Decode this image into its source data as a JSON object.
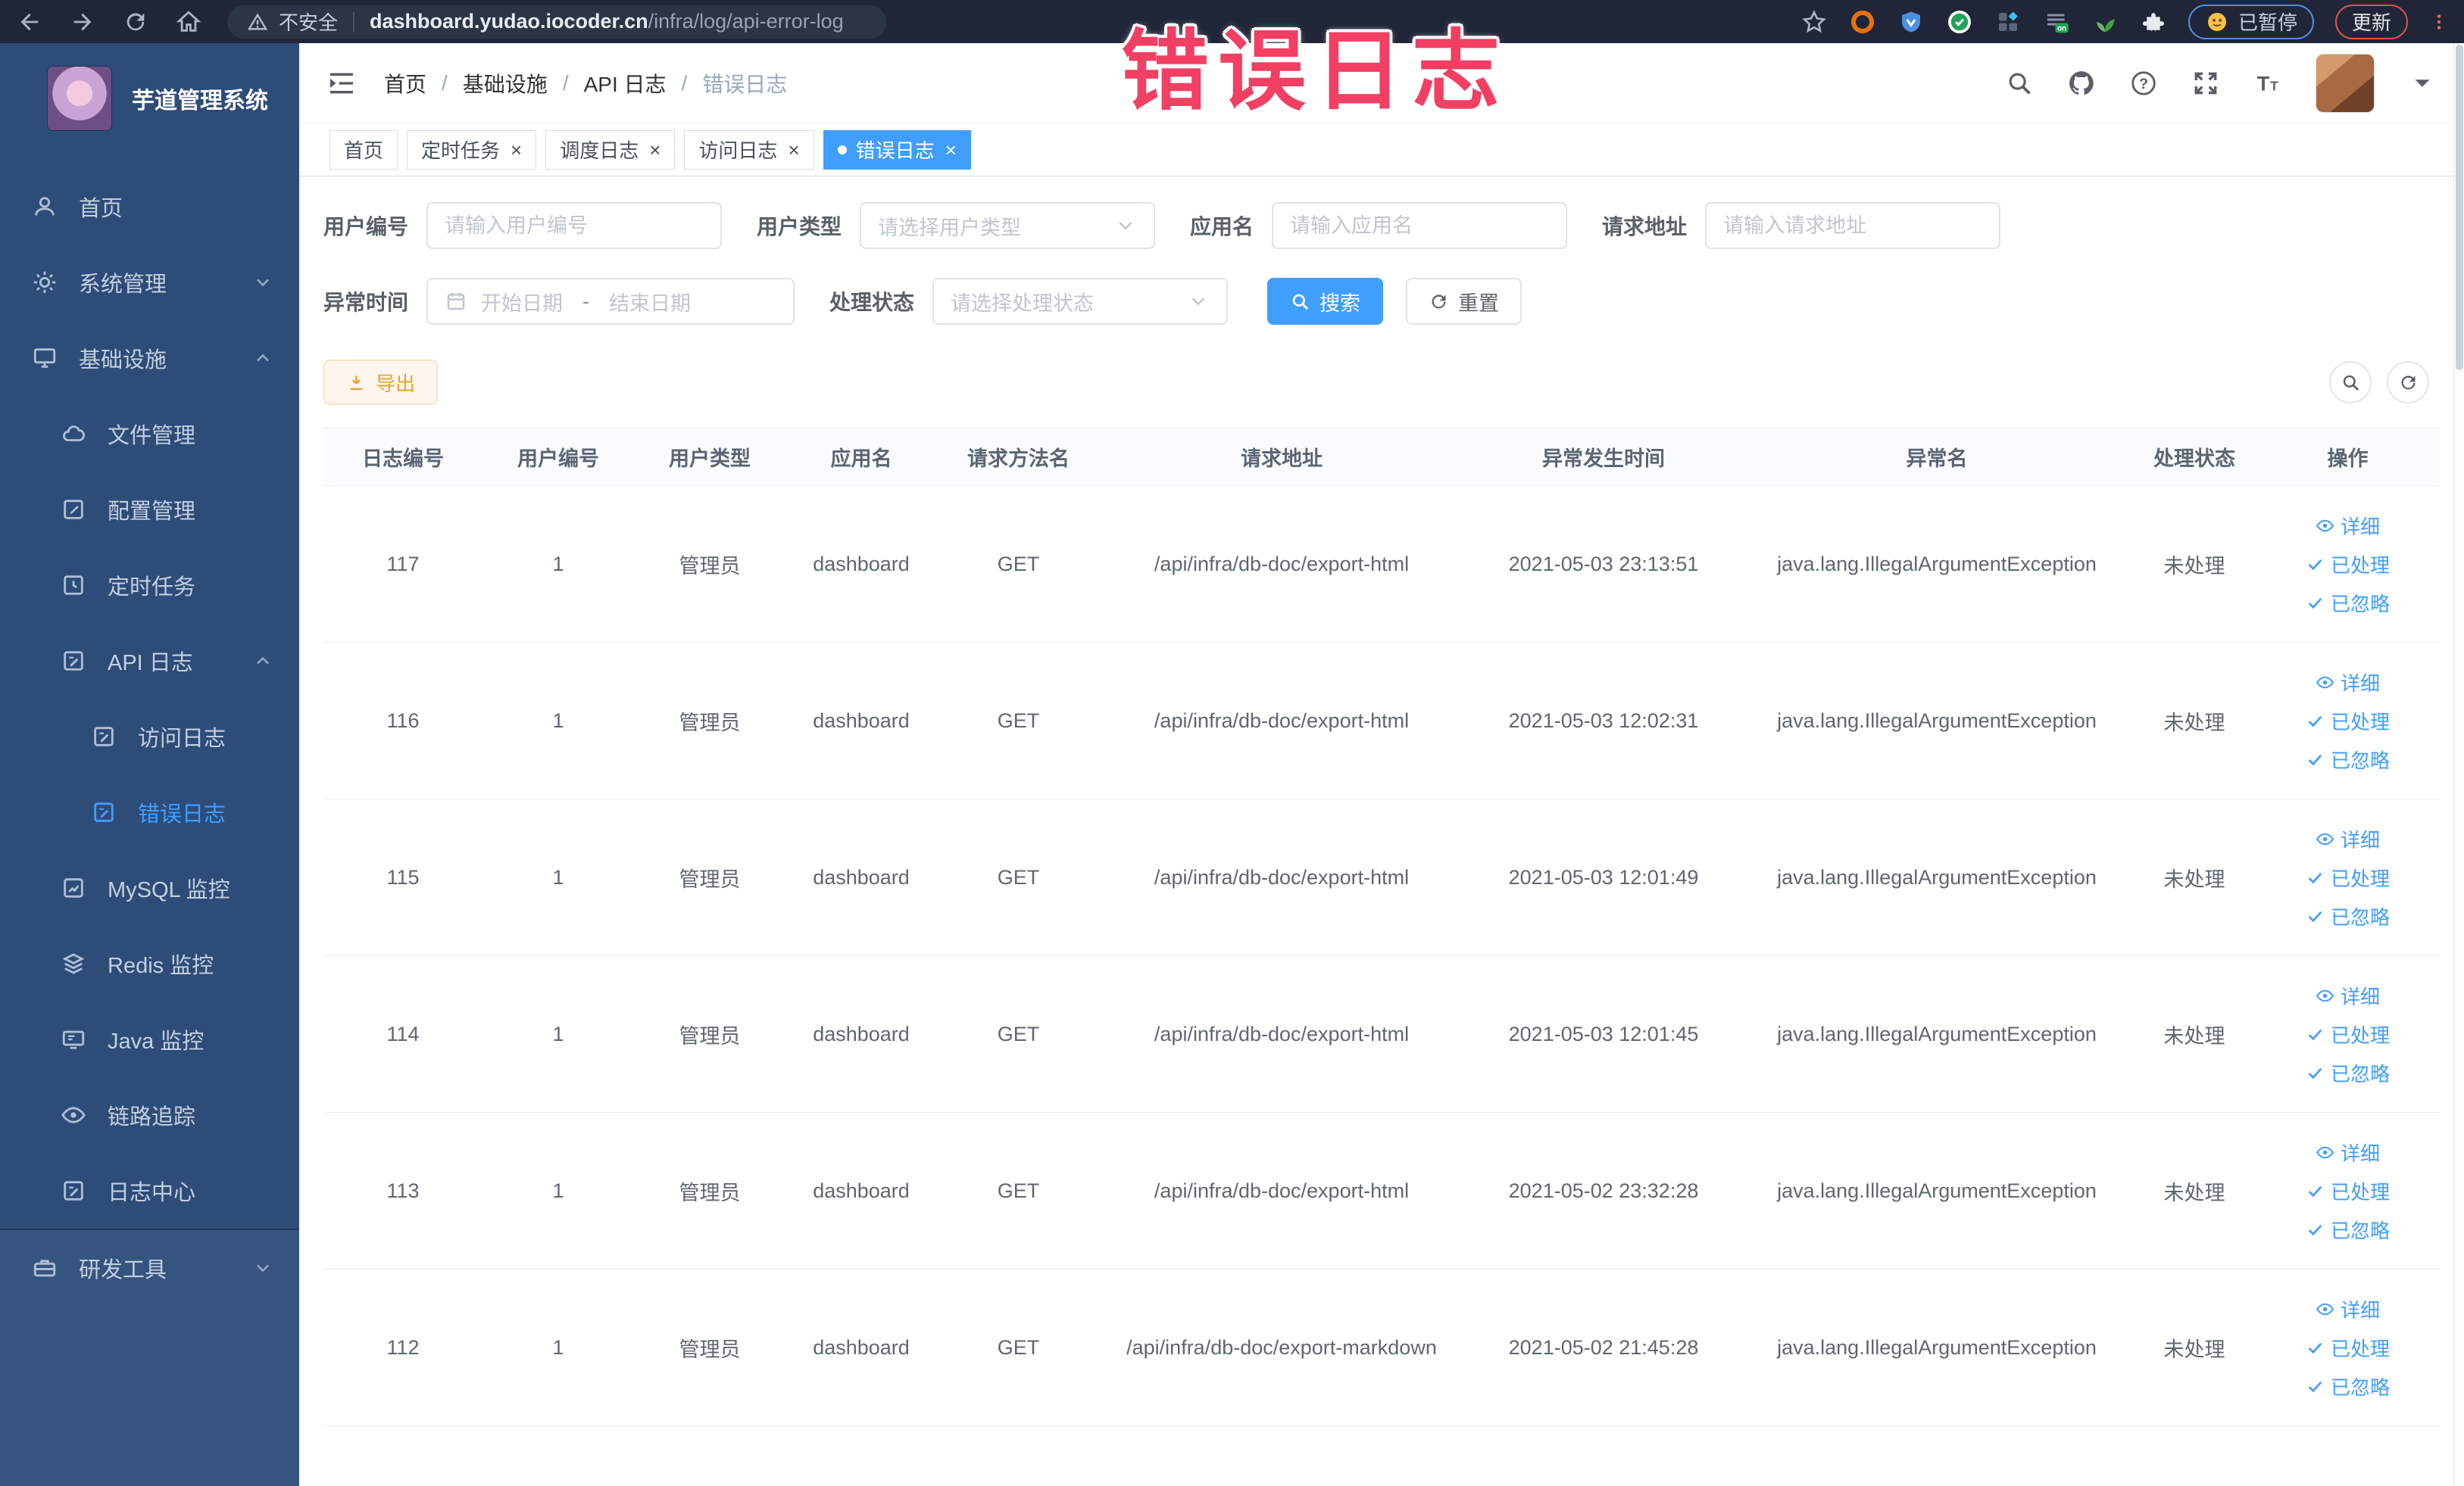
{
  "browser": {
    "security_label": "不安全",
    "url_host": "dashboard.yudao.iocoder.cn",
    "url_path": "/infra/log/api-error-log",
    "extensions": [
      "bookmark-star-icon",
      "ext-orange-icon",
      "ext-shield-icon",
      "ext-green-icon",
      "ext-grid-icon",
      "ext-on-icon",
      "ext-leaf-icon",
      "puzzle-icon"
    ],
    "paused_badge": "已暂停",
    "update_button": "更新"
  },
  "overlay": {
    "text": "错误日志",
    "color": "#f23f63"
  },
  "sidebar": {
    "title": "芋道管理系统",
    "items": [
      {
        "key": "home",
        "label": "首页",
        "icon": "user-icon",
        "level": 0
      },
      {
        "key": "system-management",
        "label": "系统管理",
        "icon": "gear-icon",
        "level": 0,
        "chevron": "down"
      },
      {
        "key": "infrastructure",
        "label": "基础设施",
        "icon": "monitor-icon",
        "level": 0,
        "chevron": "up"
      },
      {
        "key": "file-management",
        "label": "文件管理",
        "icon": "cloud-icon",
        "level": 1
      },
      {
        "key": "config-management",
        "label": "配置管理",
        "icon": "edit-icon",
        "level": 1
      },
      {
        "key": "scheduled-tasks",
        "label": "定时任务",
        "icon": "clock-icon",
        "level": 1
      },
      {
        "key": "api-log",
        "label": "API 日志",
        "icon": "log-icon",
        "level": 1,
        "chevron": "up"
      },
      {
        "key": "access-log",
        "label": "访问日志",
        "icon": "log-icon",
        "level": 2
      },
      {
        "key": "error-log",
        "label": "错误日志",
        "icon": "log-icon",
        "level": 2,
        "active": true
      },
      {
        "key": "mysql-monitor",
        "label": "MySQL 监控",
        "icon": "chart-icon",
        "level": 1
      },
      {
        "key": "redis-monitor",
        "label": "Redis 监控",
        "icon": "layers-icon",
        "level": 1
      },
      {
        "key": "java-monitor",
        "label": "Java 监控",
        "icon": "screen-icon",
        "level": 1
      },
      {
        "key": "tracing",
        "label": "链路追踪",
        "icon": "eye-icon",
        "level": 1
      },
      {
        "key": "log-center",
        "label": "日志中心",
        "icon": "log-icon",
        "level": 1
      },
      {
        "key": "dev-tools",
        "label": "研发工具",
        "icon": "toolbox-icon",
        "level": 0,
        "chevron": "down",
        "section": "dev"
      }
    ]
  },
  "header": {
    "breadcrumb": [
      "首页",
      "基础设施",
      "API 日志",
      "错误日志"
    ]
  },
  "tabs": [
    {
      "key": "home",
      "label": "首页",
      "closable": false,
      "active": false
    },
    {
      "key": "job",
      "label": "定时任务",
      "closable": true,
      "active": false
    },
    {
      "key": "job-log",
      "label": "调度日志",
      "closable": true,
      "active": false
    },
    {
      "key": "access-log",
      "label": "访问日志",
      "closable": true,
      "active": false
    },
    {
      "key": "error-log",
      "label": "错误日志",
      "closable": true,
      "active": true
    }
  ],
  "filters": {
    "user_id": {
      "label": "用户编号",
      "placeholder": "请输入用户编号"
    },
    "user_type": {
      "label": "用户类型",
      "placeholder": "请选择用户类型"
    },
    "app_name": {
      "label": "应用名",
      "placeholder": "请输入应用名"
    },
    "request_url": {
      "label": "请求地址",
      "placeholder": "请输入请求地址"
    },
    "exception_time": {
      "label": "异常时间",
      "start_placeholder": "开始日期",
      "separator": "-",
      "end_placeholder": "结束日期"
    },
    "process_status": {
      "label": "处理状态",
      "placeholder": "请选择处理状态"
    },
    "search_button": "搜索",
    "reset_button": "重置"
  },
  "toolbar": {
    "export_button": "导出"
  },
  "table": {
    "columns": [
      "日志编号",
      "用户编号",
      "用户类型",
      "应用名",
      "请求方法名",
      "请求地址",
      "异常发生时间",
      "异常名",
      "处理状态",
      "操作"
    ],
    "actions": [
      {
        "key": "detail",
        "label": "详细"
      },
      {
        "key": "processed",
        "label": "已处理"
      },
      {
        "key": "ignored",
        "label": "已忽略"
      }
    ],
    "rows": [
      {
        "id": "117",
        "user_id": "1",
        "user_type": "管理员",
        "app": "dashboard",
        "method": "GET",
        "url": "/api/infra/db-doc/export-html",
        "time": "2021-05-03 23:13:51",
        "exception": "java.lang.IllegalArgumentException",
        "status": "未处理"
      },
      {
        "id": "116",
        "user_id": "1",
        "user_type": "管理员",
        "app": "dashboard",
        "method": "GET",
        "url": "/api/infra/db-doc/export-html",
        "time": "2021-05-03 12:02:31",
        "exception": "java.lang.IllegalArgumentException",
        "status": "未处理"
      },
      {
        "id": "115",
        "user_id": "1",
        "user_type": "管理员",
        "app": "dashboard",
        "method": "GET",
        "url": "/api/infra/db-doc/export-html",
        "time": "2021-05-03 12:01:49",
        "exception": "java.lang.IllegalArgumentException",
        "status": "未处理"
      },
      {
        "id": "114",
        "user_id": "1",
        "user_type": "管理员",
        "app": "dashboard",
        "method": "GET",
        "url": "/api/infra/db-doc/export-html",
        "time": "2021-05-03 12:01:45",
        "exception": "java.lang.IllegalArgumentException",
        "status": "未处理"
      },
      {
        "id": "113",
        "user_id": "1",
        "user_type": "管理员",
        "app": "dashboard",
        "method": "GET",
        "url": "/api/infra/db-doc/export-html",
        "time": "2021-05-02 23:32:28",
        "exception": "java.lang.IllegalArgumentException",
        "status": "未处理"
      },
      {
        "id": "112",
        "user_id": "1",
        "user_type": "管理员",
        "app": "dashboard",
        "method": "GET",
        "url": "/api/infra/db-doc/export-markdown",
        "time": "2021-05-02 21:45:28",
        "exception": "java.lang.IllegalArgumentException",
        "status": "未处理"
      }
    ]
  },
  "theme": {
    "accent": "#409eff",
    "sidebar_bg": "#2e4c78",
    "warning": "#e6a23c",
    "active_tab": "#409eff"
  }
}
